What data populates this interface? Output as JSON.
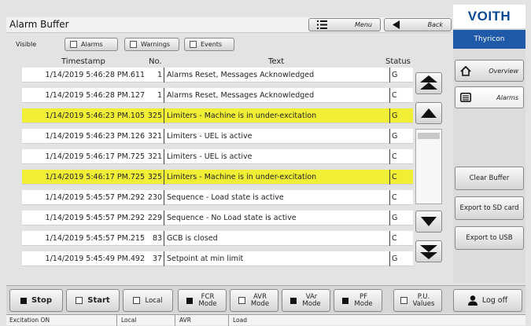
{
  "title": "Alarm Buffer",
  "header": {
    "menu_label": "Menu",
    "back_label": "Back"
  },
  "filters": {
    "visible_label": "Visible",
    "alarms_label": "Alarms",
    "warnings_label": "Warnings",
    "events_label": "Events"
  },
  "columns": {
    "timestamp": "Timestamp",
    "no": "No.",
    "text": "Text",
    "status": "Status"
  },
  "rows": [
    {
      "timestamp": "1/14/2019 5:46:28 PM.611",
      "no": "1",
      "text": "Alarms Reset, Messages Acknowledged",
      "status": "G",
      "highlight": false
    },
    {
      "timestamp": "1/14/2019 5:46:28 PM.127",
      "no": "1",
      "text": "Alarms Reset, Messages Acknowledged",
      "status": "C",
      "highlight": false
    },
    {
      "timestamp": "1/14/2019 5:46:23 PM.105",
      "no": "325",
      "text": "Limiters - Machine is in under-excitation",
      "status": "G",
      "highlight": true
    },
    {
      "timestamp": "1/14/2019 5:46:23 PM.126",
      "no": "321",
      "text": "Limiters - UEL is active",
      "status": "G",
      "highlight": false
    },
    {
      "timestamp": "1/14/2019 5:46:17 PM.725",
      "no": "321",
      "text": "Limiters - UEL is active",
      "status": "C",
      "highlight": false
    },
    {
      "timestamp": "1/14/2019 5:46:17 PM.725",
      "no": "325",
      "text": "Limiters - Machine is in under-excitation",
      "status": "C",
      "highlight": true
    },
    {
      "timestamp": "1/14/2019 5:45:57 PM.292",
      "no": "230",
      "text": "Sequence - Load state is active",
      "status": "C",
      "highlight": false
    },
    {
      "timestamp": "1/14/2019 5:45:57 PM.292",
      "no": "229",
      "text": "Sequence - No Load state is active",
      "status": "G",
      "highlight": false
    },
    {
      "timestamp": "1/14/2019 5:45:57 PM.215",
      "no": "83",
      "text": "GCB is closed",
      "status": "C",
      "highlight": false
    },
    {
      "timestamp": "1/14/2019 5:45:49 PM.492",
      "no": "37",
      "text": "Setpoint at min limit",
      "status": "G",
      "highlight": false
    }
  ],
  "sidebar": {
    "logo": "VOITH",
    "product": "Thyricon",
    "nav_overview": "Overview",
    "nav_alarms": "Alarms",
    "clear_buffer": "Clear Buffer",
    "export_sd": "Export to SD card",
    "export_usb": "Export to USB"
  },
  "bottom_bar": {
    "stop": "Stop",
    "start": "Start",
    "local": "Local",
    "fcr_mode": "FCR Mode",
    "avr_mode": "AVR Mode",
    "var_mode": "VAr Mode",
    "pf_mode": "PF Mode",
    "pu_values": "P.U. Values",
    "log_off": "Log off"
  },
  "status_bar": {
    "excitation": "Excitation ON",
    "local": "Local",
    "mode": "AVR",
    "state": "Load"
  },
  "colors": {
    "highlight": "#f1ef35",
    "product_bar": "#1f59a8",
    "logo": "#0b4a92"
  }
}
